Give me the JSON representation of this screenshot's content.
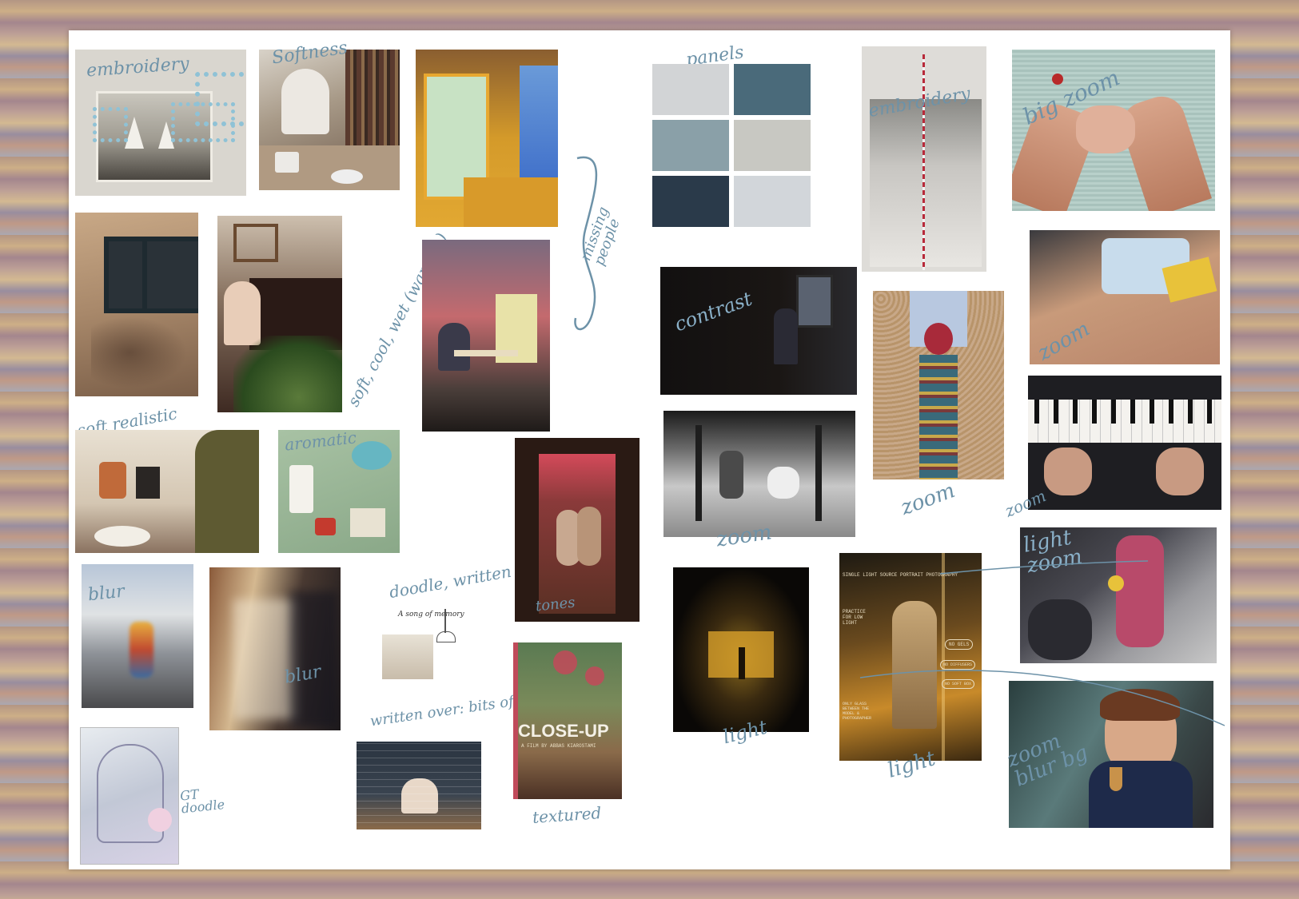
{
  "annotations": {
    "embroidery_1": "embroidery",
    "softness": "Softness",
    "missing_people": "missing people",
    "panels": "panels",
    "embroidery_2": "embroidery",
    "big_zoom": "big zoom",
    "soft_cool_wet": "soft, cool, wet (warmth)",
    "contrast": "contrast",
    "zoom_hands": "zoom",
    "soft_realistic": "soft realistic",
    "aromatic": "aromatic",
    "zoom_tie": "zoom",
    "zoom_piano": "zoom",
    "zoom_table": "zoom",
    "blur_1": "blur",
    "blur_2": "blur",
    "doodle_written": "doodle, written",
    "tones": "tones",
    "light_zoom": "light zoom",
    "written_over": "written over: bits of poem",
    "light_1": "light",
    "light_2": "light",
    "gt_doodle": "GT doodle",
    "textured": "textured",
    "zoom_blur_bg": "zoom blur bg"
  },
  "poster": {
    "title": "CLOSE-UP",
    "subtitle": "A FILM BY ABBAS KIAROSTAMI"
  },
  "portrait_poster": {
    "header": "SINGLE LIGHT SOURCE PORTRAIT PHOTOGRAPHY",
    "note_left": "PRACTICE FOR LOW LIGHT",
    "bubble_1": "NO GELS",
    "bubble_2": "NO DIFFUSERS",
    "bubble_3": "NO SOFT BOX",
    "footer": "ONLY GLASS BETWEEN THE MODEL & PHOTOGRAPHER"
  },
  "doodle_note": "A song of memory"
}
